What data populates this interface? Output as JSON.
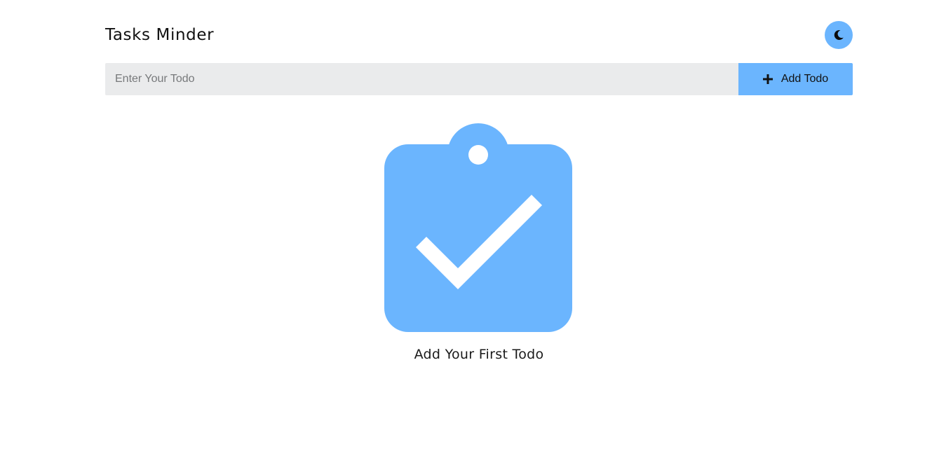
{
  "app": {
    "title": "Tasks Minder"
  },
  "header": {
    "theme_toggle_icon": "moon-icon"
  },
  "todo_form": {
    "input_value": "",
    "input_placeholder": "Enter Your Todo",
    "add_button_label": "Add Todo",
    "add_button_icon": "plus-icon"
  },
  "empty_state": {
    "icon": "clipboard-check-icon",
    "message": "Add Your First Todo"
  },
  "colors": {
    "accent": "#6bb5fe",
    "input_background": "#eaebec",
    "text": "#111111",
    "background": "#ffffff"
  }
}
